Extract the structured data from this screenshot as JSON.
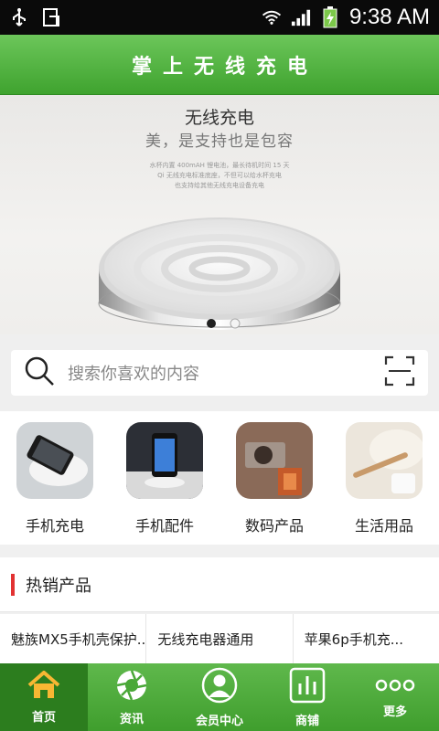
{
  "status_bar": {
    "time": "9:38 AM"
  },
  "app_bar": {
    "title": "掌上无线充电"
  },
  "banner": {
    "headline": "无线充电",
    "subheadline": "美，是支持也是包容",
    "desc_lines": [
      "水杯内置 400mAH 锂电池，最长待机时间 15 天",
      "Qi 无线充电标准底座，不但可以给水杯充电",
      "也支持给其他无线充电设备充电"
    ]
  },
  "search": {
    "placeholder": "搜索你喜欢的内容"
  },
  "categories": [
    {
      "label": "手机充电",
      "icon": "wireless-charger-image"
    },
    {
      "label": "手机配件",
      "icon": "phone-stand-image"
    },
    {
      "label": "数码产品",
      "icon": "camera-image"
    },
    {
      "label": "生活用品",
      "icon": "toothbrush-image"
    }
  ],
  "hot": {
    "title": "热销产品"
  },
  "products": [
    "魅族MX5手机壳保护...",
    "无线充电器通用",
    "苹果6p手机充..."
  ],
  "tabs": [
    {
      "label": "首页",
      "icon": "home-icon"
    },
    {
      "label": "资讯",
      "icon": "aperture-icon"
    },
    {
      "label": "会员中心",
      "icon": "user-icon"
    },
    {
      "label": "商铺",
      "icon": "shop-icon"
    },
    {
      "label": "更多",
      "icon": "more-icon"
    }
  ],
  "colors": {
    "accent": "#4cad3a",
    "active_tab": "#2c7d1e",
    "hot_bar": "#e23232"
  }
}
